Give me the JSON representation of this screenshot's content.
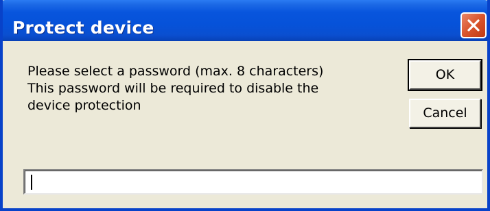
{
  "dialog": {
    "title": "Protect device",
    "message_lines": [
      "Please select a password (max. 8 characters)",
      "This password will be required to disable the",
      "device protection"
    ],
    "ok_label": "OK",
    "cancel_label": "Cancel",
    "password_value": "",
    "close_icon": "close-icon"
  },
  "colors": {
    "titlebar": "#0652d9",
    "dialog_background": "#ece9d8",
    "close_button": "#d9542c"
  }
}
